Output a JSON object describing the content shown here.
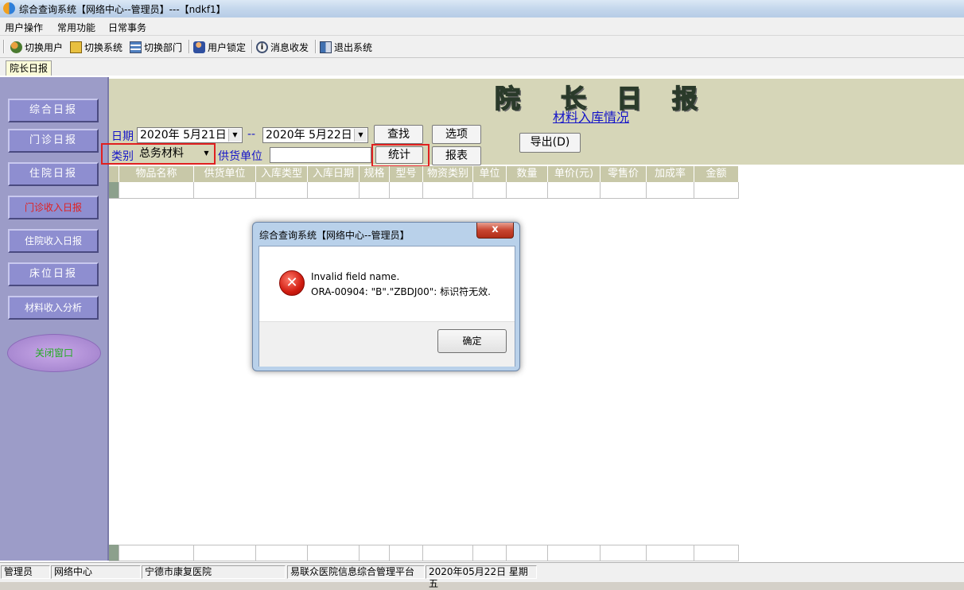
{
  "window": {
    "title": "综合查询系统【网络中心--管理员】---【ndkf1】"
  },
  "menu": [
    "用户操作",
    "常用功能",
    "日常事务"
  ],
  "toolbar": [
    "切换用户",
    "切换系统",
    "切换部门",
    "用户锁定",
    "消息收发",
    "退出系统"
  ],
  "tab": "院长日报",
  "sidebar": [
    "综合日报",
    "门诊日报",
    "住院日报",
    "门诊收入日报",
    "住院收入日报",
    "床位日报",
    "材料收入分析",
    "关闭窗口"
  ],
  "header": {
    "title_chars": [
      "院",
      "长",
      "日",
      "报"
    ],
    "subtitle": "材料入库情况"
  },
  "filter": {
    "date_label": "日期",
    "date_from": "2020年  5月21日",
    "date_sep": "--",
    "date_to": "2020年  5月22日",
    "category_label": "类别",
    "category_value": "总务材料",
    "supplier_label": "供货单位",
    "supplier_value": "",
    "search": "查找",
    "options": "选项",
    "stats": "统计",
    "report": "报表",
    "export": "导出(D)"
  },
  "grid": {
    "columns": [
      "物品名称",
      "供货单位",
      "入库类型",
      "入库日期",
      "规格",
      "型号",
      "物资类别",
      "单位",
      "数量",
      "单价(元)",
      "零售价",
      "加成率",
      "金额"
    ]
  },
  "dialog": {
    "title": "综合查询系统【网络中心--管理员】",
    "close": "x",
    "message_line1": "Invalid field name.",
    "message_line2": "ORA-00904: \"B\".\"ZBDJ00\": 标识符无效.",
    "ok": "确定"
  },
  "status": [
    "管理员",
    "网络中心",
    "宁德市康复医院",
    "易联众医院信息综合管理平台",
    "2020年05月22日 星期五"
  ],
  "colors": {
    "accent": "#1414c8",
    "sidebar": "#9c9cc8",
    "highlight": "#e02020"
  }
}
